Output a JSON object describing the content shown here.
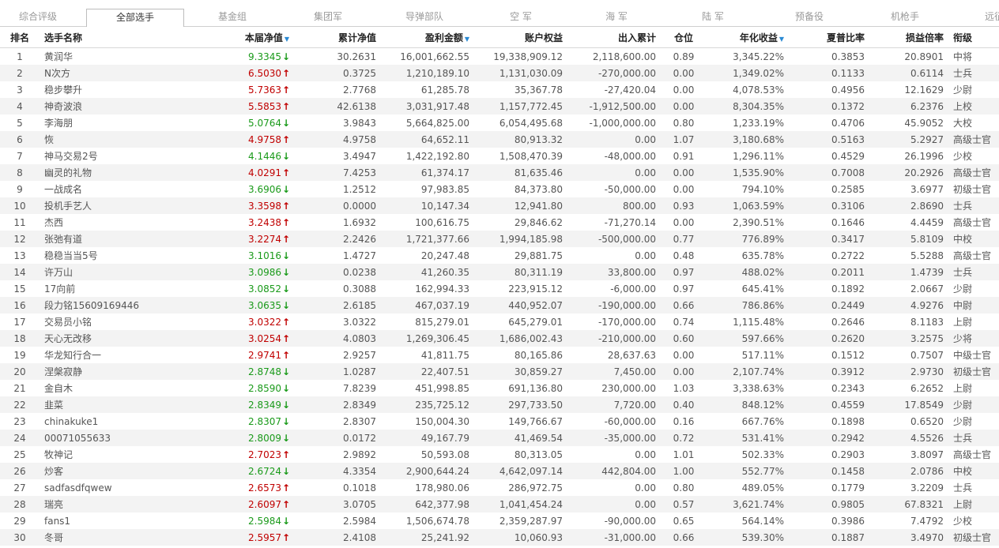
{
  "tabs": [
    {
      "label": "综合评级",
      "active": false
    },
    {
      "label": "全部选手",
      "active": true
    },
    {
      "label": "基金组",
      "active": false
    },
    {
      "label": "集团军",
      "active": false
    },
    {
      "label": "导弹部队",
      "active": false
    },
    {
      "label": "空 军",
      "active": false
    },
    {
      "label": "海 军",
      "active": false
    },
    {
      "label": "陆 军",
      "active": false
    },
    {
      "label": "预备役",
      "active": false
    },
    {
      "label": "机枪手",
      "active": false
    },
    {
      "label": "远征",
      "active": false
    }
  ],
  "columns": {
    "rank": "排名",
    "name": "选手名称",
    "nav": "本届净值",
    "cum_nav": "累计净值",
    "profit": "盈利金额",
    "equity": "账户权益",
    "inout": "出入累计",
    "position": "仓位",
    "annual": "年化收益",
    "sharpe": "夏普比率",
    "pl_ratio": "损益倍率",
    "title": "衔级"
  },
  "sort_icon": "sort-down-triangle-icon",
  "colors": {
    "up": "#c00000",
    "down": "#1a9a1a",
    "sort": "#2a8ad4"
  },
  "rows": [
    {
      "rank": "1",
      "name": "黄润华",
      "nav": "9.3345",
      "dir": "down",
      "cum_nav": "30.2631",
      "profit": "16,001,662.55",
      "equity": "19,338,909.12",
      "inout": "2,118,600.00",
      "position": "0.89",
      "annual": "3,345.22%",
      "sharpe": "0.3853",
      "pl_ratio": "20.8901",
      "title": "中将"
    },
    {
      "rank": "2",
      "name": "N次方",
      "nav": "6.5030",
      "dir": "up",
      "cum_nav": "0.3725",
      "profit": "1,210,189.10",
      "equity": "1,131,030.09",
      "inout": "-270,000.00",
      "position": "0.00",
      "annual": "1,349.02%",
      "sharpe": "0.1133",
      "pl_ratio": "0.6114",
      "title": "士兵"
    },
    {
      "rank": "3",
      "name": "稳步攀升",
      "nav": "5.7363",
      "dir": "up",
      "cum_nav": "2.7768",
      "profit": "61,285.78",
      "equity": "35,367.78",
      "inout": "-27,420.04",
      "position": "0.00",
      "annual": "4,078.53%",
      "sharpe": "0.4956",
      "pl_ratio": "12.1629",
      "title": "少尉"
    },
    {
      "rank": "4",
      "name": "神奇波浪",
      "nav": "5.5853",
      "dir": "up",
      "cum_nav": "42.6138",
      "profit": "3,031,917.48",
      "equity": "1,157,772.45",
      "inout": "-1,912,500.00",
      "position": "0.00",
      "annual": "8,304.35%",
      "sharpe": "0.1372",
      "pl_ratio": "6.2376",
      "title": "上校"
    },
    {
      "rank": "5",
      "name": "李海朋",
      "nav": "5.0764",
      "dir": "down",
      "cum_nav": "3.9843",
      "profit": "5,664,825.00",
      "equity": "6,054,495.68",
      "inout": "-1,000,000.00",
      "position": "0.80",
      "annual": "1,233.19%",
      "sharpe": "0.4706",
      "pl_ratio": "45.9052",
      "title": "大校"
    },
    {
      "rank": "6",
      "name": "恢",
      "nav": "4.9758",
      "dir": "up",
      "cum_nav": "4.9758",
      "profit": "64,652.11",
      "equity": "80,913.32",
      "inout": "0.00",
      "position": "1.07",
      "annual": "3,180.68%",
      "sharpe": "0.5163",
      "pl_ratio": "5.2927",
      "title": "高级士官"
    },
    {
      "rank": "7",
      "name": "神马交易2号",
      "nav": "4.1446",
      "dir": "down",
      "cum_nav": "3.4947",
      "profit": "1,422,192.80",
      "equity": "1,508,470.39",
      "inout": "-48,000.00",
      "position": "0.91",
      "annual": "1,296.11%",
      "sharpe": "0.4529",
      "pl_ratio": "26.1996",
      "title": "少校"
    },
    {
      "rank": "8",
      "name": "幽灵的礼物",
      "nav": "4.0291",
      "dir": "up",
      "cum_nav": "7.4253",
      "profit": "61,374.17",
      "equity": "81,635.46",
      "inout": "0.00",
      "position": "0.00",
      "annual": "1,535.90%",
      "sharpe": "0.7008",
      "pl_ratio": "20.2926",
      "title": "高级士官"
    },
    {
      "rank": "9",
      "name": "一战成名",
      "nav": "3.6906",
      "dir": "down",
      "cum_nav": "1.2512",
      "profit": "97,983.85",
      "equity": "84,373.80",
      "inout": "-50,000.00",
      "position": "0.00",
      "annual": "794.10%",
      "sharpe": "0.2585",
      "pl_ratio": "3.6977",
      "title": "初级士官"
    },
    {
      "rank": "10",
      "name": "投机手艺人",
      "nav": "3.3598",
      "dir": "up",
      "cum_nav": "0.0000",
      "profit": "10,147.34",
      "equity": "12,941.80",
      "inout": "800.00",
      "position": "0.93",
      "annual": "1,063.59%",
      "sharpe": "0.3106",
      "pl_ratio": "2.8690",
      "title": "士兵"
    },
    {
      "rank": "11",
      "name": "杰西",
      "nav": "3.2438",
      "dir": "up",
      "cum_nav": "1.6932",
      "profit": "100,616.75",
      "equity": "29,846.62",
      "inout": "-71,270.14",
      "position": "0.00",
      "annual": "2,390.51%",
      "sharpe": "0.1646",
      "pl_ratio": "4.4459",
      "title": "高级士官"
    },
    {
      "rank": "12",
      "name": "张弛有道",
      "nav": "3.2274",
      "dir": "up",
      "cum_nav": "2.2426",
      "profit": "1,721,377.66",
      "equity": "1,994,185.98",
      "inout": "-500,000.00",
      "position": "0.77",
      "annual": "776.89%",
      "sharpe": "0.3417",
      "pl_ratio": "5.8109",
      "title": "中校"
    },
    {
      "rank": "13",
      "name": "稳稳当当5号",
      "nav": "3.1016",
      "dir": "down",
      "cum_nav": "1.4727",
      "profit": "20,247.48",
      "equity": "29,881.75",
      "inout": "0.00",
      "position": "0.48",
      "annual": "635.78%",
      "sharpe": "0.2722",
      "pl_ratio": "5.5288",
      "title": "高级士官"
    },
    {
      "rank": "14",
      "name": "许万山",
      "nav": "3.0986",
      "dir": "down",
      "cum_nav": "0.0238",
      "profit": "41,260.35",
      "equity": "80,311.19",
      "inout": "33,800.00",
      "position": "0.97",
      "annual": "488.02%",
      "sharpe": "0.2011",
      "pl_ratio": "1.4739",
      "title": "士兵"
    },
    {
      "rank": "15",
      "name": "17向前",
      "nav": "3.0852",
      "dir": "down",
      "cum_nav": "0.3088",
      "profit": "162,994.33",
      "equity": "223,915.12",
      "inout": "-6,000.00",
      "position": "0.97",
      "annual": "645.41%",
      "sharpe": "0.1892",
      "pl_ratio": "2.0667",
      "title": "少尉"
    },
    {
      "rank": "16",
      "name": "段力铭15609169446",
      "nav": "3.0635",
      "dir": "down",
      "cum_nav": "2.6185",
      "profit": "467,037.19",
      "equity": "440,952.07",
      "inout": "-190,000.00",
      "position": "0.66",
      "annual": "786.86%",
      "sharpe": "0.2449",
      "pl_ratio": "4.9276",
      "title": "中尉"
    },
    {
      "rank": "17",
      "name": "交易员小铭",
      "nav": "3.0322",
      "dir": "up",
      "cum_nav": "3.0322",
      "profit": "815,279.01",
      "equity": "645,279.01",
      "inout": "-170,000.00",
      "position": "0.74",
      "annual": "1,115.48%",
      "sharpe": "0.2646",
      "pl_ratio": "8.1183",
      "title": "上尉"
    },
    {
      "rank": "18",
      "name": "天心无改移",
      "nav": "3.0254",
      "dir": "up",
      "cum_nav": "4.0803",
      "profit": "1,269,306.45",
      "equity": "1,686,002.43",
      "inout": "-210,000.00",
      "position": "0.60",
      "annual": "597.66%",
      "sharpe": "0.2620",
      "pl_ratio": "3.2575",
      "title": "少将"
    },
    {
      "rank": "19",
      "name": "华龙知行合一",
      "nav": "2.9741",
      "dir": "up",
      "cum_nav": "2.9257",
      "profit": "41,811.75",
      "equity": "80,165.86",
      "inout": "28,637.63",
      "position": "0.00",
      "annual": "517.11%",
      "sharpe": "0.1512",
      "pl_ratio": "0.7507",
      "title": "中级士官"
    },
    {
      "rank": "20",
      "name": "涅槃寂静",
      "nav": "2.8748",
      "dir": "down",
      "cum_nav": "1.0287",
      "profit": "22,407.51",
      "equity": "30,859.27",
      "inout": "7,450.00",
      "position": "0.00",
      "annual": "2,107.74%",
      "sharpe": "0.3912",
      "pl_ratio": "2.9730",
      "title": "初级士官"
    },
    {
      "rank": "21",
      "name": "金自木",
      "nav": "2.8590",
      "dir": "down",
      "cum_nav": "7.8239",
      "profit": "451,998.85",
      "equity": "691,136.80",
      "inout": "230,000.00",
      "position": "1.03",
      "annual": "3,338.63%",
      "sharpe": "0.2343",
      "pl_ratio": "6.2652",
      "title": "上尉"
    },
    {
      "rank": "22",
      "name": "韭菜",
      "nav": "2.8349",
      "dir": "down",
      "cum_nav": "2.8349",
      "profit": "235,725.12",
      "equity": "297,733.50",
      "inout": "7,720.00",
      "position": "0.40",
      "annual": "848.12%",
      "sharpe": "0.4559",
      "pl_ratio": "17.8549",
      "title": "少尉"
    },
    {
      "rank": "23",
      "name": "chinakuke1",
      "nav": "2.8307",
      "dir": "down",
      "cum_nav": "2.8307",
      "profit": "150,004.30",
      "equity": "149,766.67",
      "inout": "-60,000.00",
      "position": "0.16",
      "annual": "667.76%",
      "sharpe": "0.1898",
      "pl_ratio": "0.6520",
      "title": "少尉"
    },
    {
      "rank": "24",
      "name": "00071055633",
      "nav": "2.8009",
      "dir": "down",
      "cum_nav": "0.0172",
      "profit": "49,167.79",
      "equity": "41,469.54",
      "inout": "-35,000.00",
      "position": "0.72",
      "annual": "531.41%",
      "sharpe": "0.2942",
      "pl_ratio": "4.5526",
      "title": "士兵"
    },
    {
      "rank": "25",
      "name": "牧神记",
      "nav": "2.7023",
      "dir": "up",
      "cum_nav": "2.9892",
      "profit": "50,593.08",
      "equity": "80,313.05",
      "inout": "0.00",
      "position": "1.01",
      "annual": "502.33%",
      "sharpe": "0.2903",
      "pl_ratio": "3.8097",
      "title": "高级士官"
    },
    {
      "rank": "26",
      "name": "炒客",
      "nav": "2.6724",
      "dir": "down",
      "cum_nav": "4.3354",
      "profit": "2,900,644.24",
      "equity": "4,642,097.14",
      "inout": "442,804.00",
      "position": "1.00",
      "annual": "552.77%",
      "sharpe": "0.1458",
      "pl_ratio": "2.0786",
      "title": "中校"
    },
    {
      "rank": "27",
      "name": "sadfasdfqwew",
      "nav": "2.6573",
      "dir": "up",
      "cum_nav": "0.1018",
      "profit": "178,980.06",
      "equity": "286,972.75",
      "inout": "0.00",
      "position": "0.80",
      "annual": "489.05%",
      "sharpe": "0.1779",
      "pl_ratio": "3.2209",
      "title": "士兵"
    },
    {
      "rank": "28",
      "name": "瑞亮",
      "nav": "2.6097",
      "dir": "up",
      "cum_nav": "3.0705",
      "profit": "642,377.98",
      "equity": "1,041,454.24",
      "inout": "0.00",
      "position": "0.57",
      "annual": "3,621.74%",
      "sharpe": "0.9805",
      "pl_ratio": "67.8321",
      "title": "上尉"
    },
    {
      "rank": "29",
      "name": "fans1",
      "nav": "2.5984",
      "dir": "down",
      "cum_nav": "2.5984",
      "profit": "1,506,674.78",
      "equity": "2,359,287.97",
      "inout": "-90,000.00",
      "position": "0.65",
      "annual": "564.14%",
      "sharpe": "0.3986",
      "pl_ratio": "7.4792",
      "title": "少校"
    },
    {
      "rank": "30",
      "name": "冬哥",
      "nav": "2.5957",
      "dir": "up",
      "cum_nav": "2.4108",
      "profit": "25,241.92",
      "equity": "10,060.93",
      "inout": "-31,000.00",
      "position": "0.66",
      "annual": "539.30%",
      "sharpe": "0.1887",
      "pl_ratio": "3.4970",
      "title": "初级士官"
    }
  ]
}
